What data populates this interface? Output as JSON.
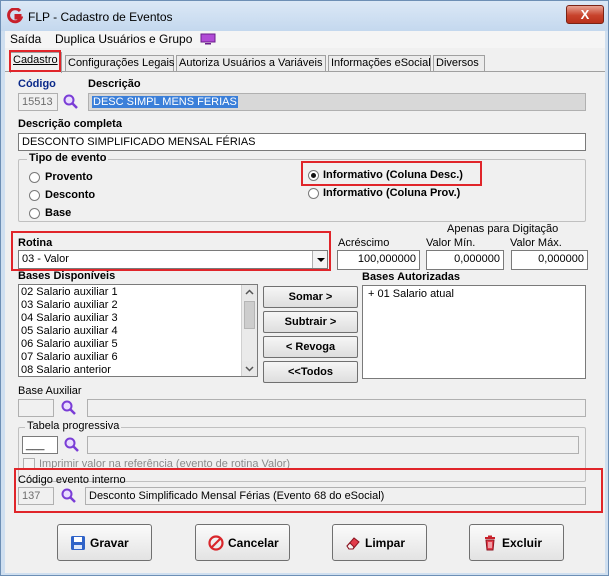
{
  "window": {
    "title": "FLP - Cadastro de Eventos",
    "close_label": "X"
  },
  "menu": {
    "items": [
      "Saída",
      "Duplica Usuários e Grupo"
    ]
  },
  "tabs": [
    "Cadastro",
    "Configurações Legais",
    "Autoriza Usuários a Variáveis",
    "Informações eSocial",
    "Diversos"
  ],
  "form": {
    "codigo_label": "Código",
    "codigo_value": "15513",
    "descricao_label": "Descrição",
    "descricao_value": "DESC SIMPL MENS FERIAS",
    "descricao_completa_label": "Descrição completa",
    "descricao_completa_value": "DESCONTO SIMPLIFICADO MENSAL FÉRIAS",
    "tipo_evento": {
      "title": "Tipo de evento",
      "options": [
        "Provento",
        "Desconto",
        "Base",
        "Informativo (Coluna Desc.)",
        "Informativo (Coluna Prov.)"
      ],
      "selected": "Informativo (Coluna Desc.)"
    },
    "rotina_label": "Rotina",
    "rotina_value": "03 - Valor",
    "acrescimo_label": "Acréscimo",
    "acrescimo_value": "100,000000",
    "apenas_digitacao_label": "Apenas para Digitação",
    "valor_min_label": "Valor Mín.",
    "valor_min_value": "0,000000",
    "valor_max_label": "Valor Máx.",
    "valor_max_value": "0,000000",
    "bases_disponiveis_label": "Bases Disponíveis",
    "bases_disponiveis": [
      "02 Salario auxiliar 1",
      "03 Salario auxiliar 2",
      "04 Salario auxiliar 3",
      "05 Salario auxiliar 4",
      "06 Salario auxiliar 5",
      "07 Salario auxiliar 6",
      "08 Salario anterior"
    ],
    "bases_autorizadas_label": "Bases Autorizadas",
    "bases_autorizadas": [
      "+ 01 Salario atual"
    ],
    "buttons": {
      "somar": "Somar >",
      "subtrair": "Subtrair >",
      "revoga": "< Revoga",
      "todos": "<<Todos"
    },
    "base_auxiliar_label": "Base Auxiliar",
    "tabela_progressiva_label": "Tabela progressiva",
    "tabela_progressiva_code": "___",
    "imprimir_label": "Imprimir valor na referência (evento de rotina Valor)",
    "codigo_interno_label": "Código evento interno",
    "codigo_interno_value": "137",
    "codigo_interno_desc": "Desconto Simplificado Mensal Férias (Evento 68 do eSocial)"
  },
  "footer": {
    "gravar": "Gravar",
    "cancelar": "Cancelar",
    "limpar": "Limpar",
    "excluir": "Excluir"
  },
  "colors": {
    "highlight_red": "#e0252a",
    "selection_blue": "#3b7fd9",
    "window_frame": "#cfdff0"
  }
}
